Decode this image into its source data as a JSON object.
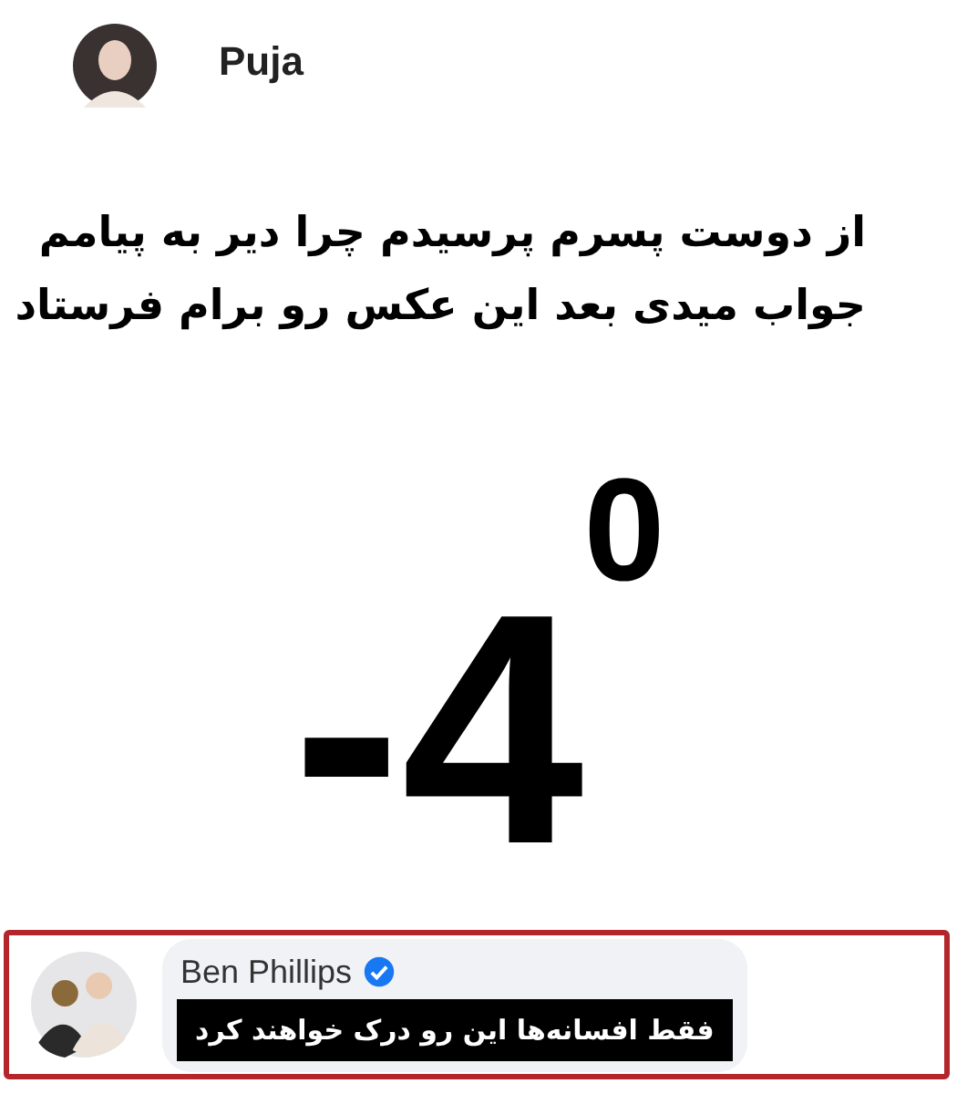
{
  "post": {
    "author": "Puja",
    "lines": [
      "از دوست پسرم پرسیدم چرا دیر به پیامم",
      "جواب میدی بعد این عکس رو برام فرستاد"
    ],
    "image_text": "-4$^{0}$"
  },
  "comment": {
    "author": "Ben Phillips",
    "verified": true,
    "text": "فقط افسانه‌ها این رو درک خواهند کرد"
  }
}
